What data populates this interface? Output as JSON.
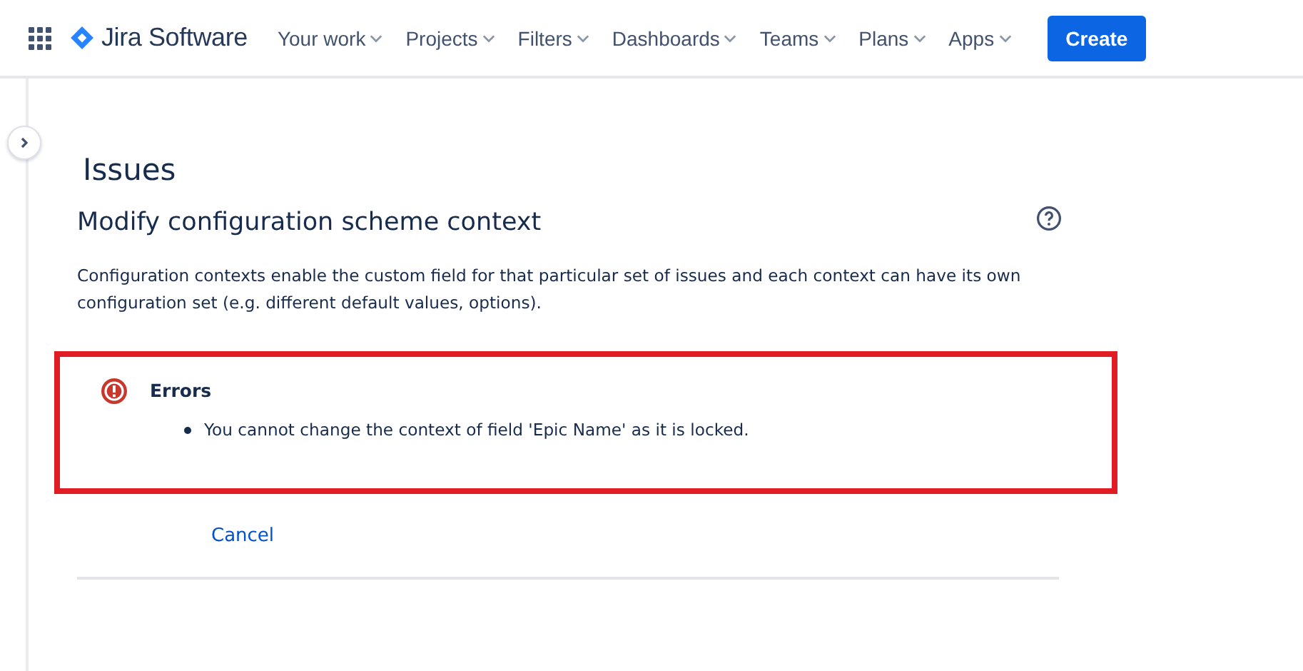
{
  "app": {
    "name": "Jira Software"
  },
  "nav": [
    {
      "label": "Your work"
    },
    {
      "label": "Projects"
    },
    {
      "label": "Filters"
    },
    {
      "label": "Dashboards"
    },
    {
      "label": "Teams"
    },
    {
      "label": "Plans"
    },
    {
      "label": "Apps"
    }
  ],
  "create_button": "Create",
  "page": {
    "title": "Issues",
    "heading": "Modify configuration scheme context",
    "description": "Configuration contexts enable the custom field for that particular set of issues and each context can have its own configuration set (e.g. different default values, options)."
  },
  "error": {
    "title": "Errors",
    "messages": [
      "You cannot change the context of field 'Epic Name' as it is locked."
    ],
    "highlighted": true
  },
  "cancel_link": "Cancel"
}
